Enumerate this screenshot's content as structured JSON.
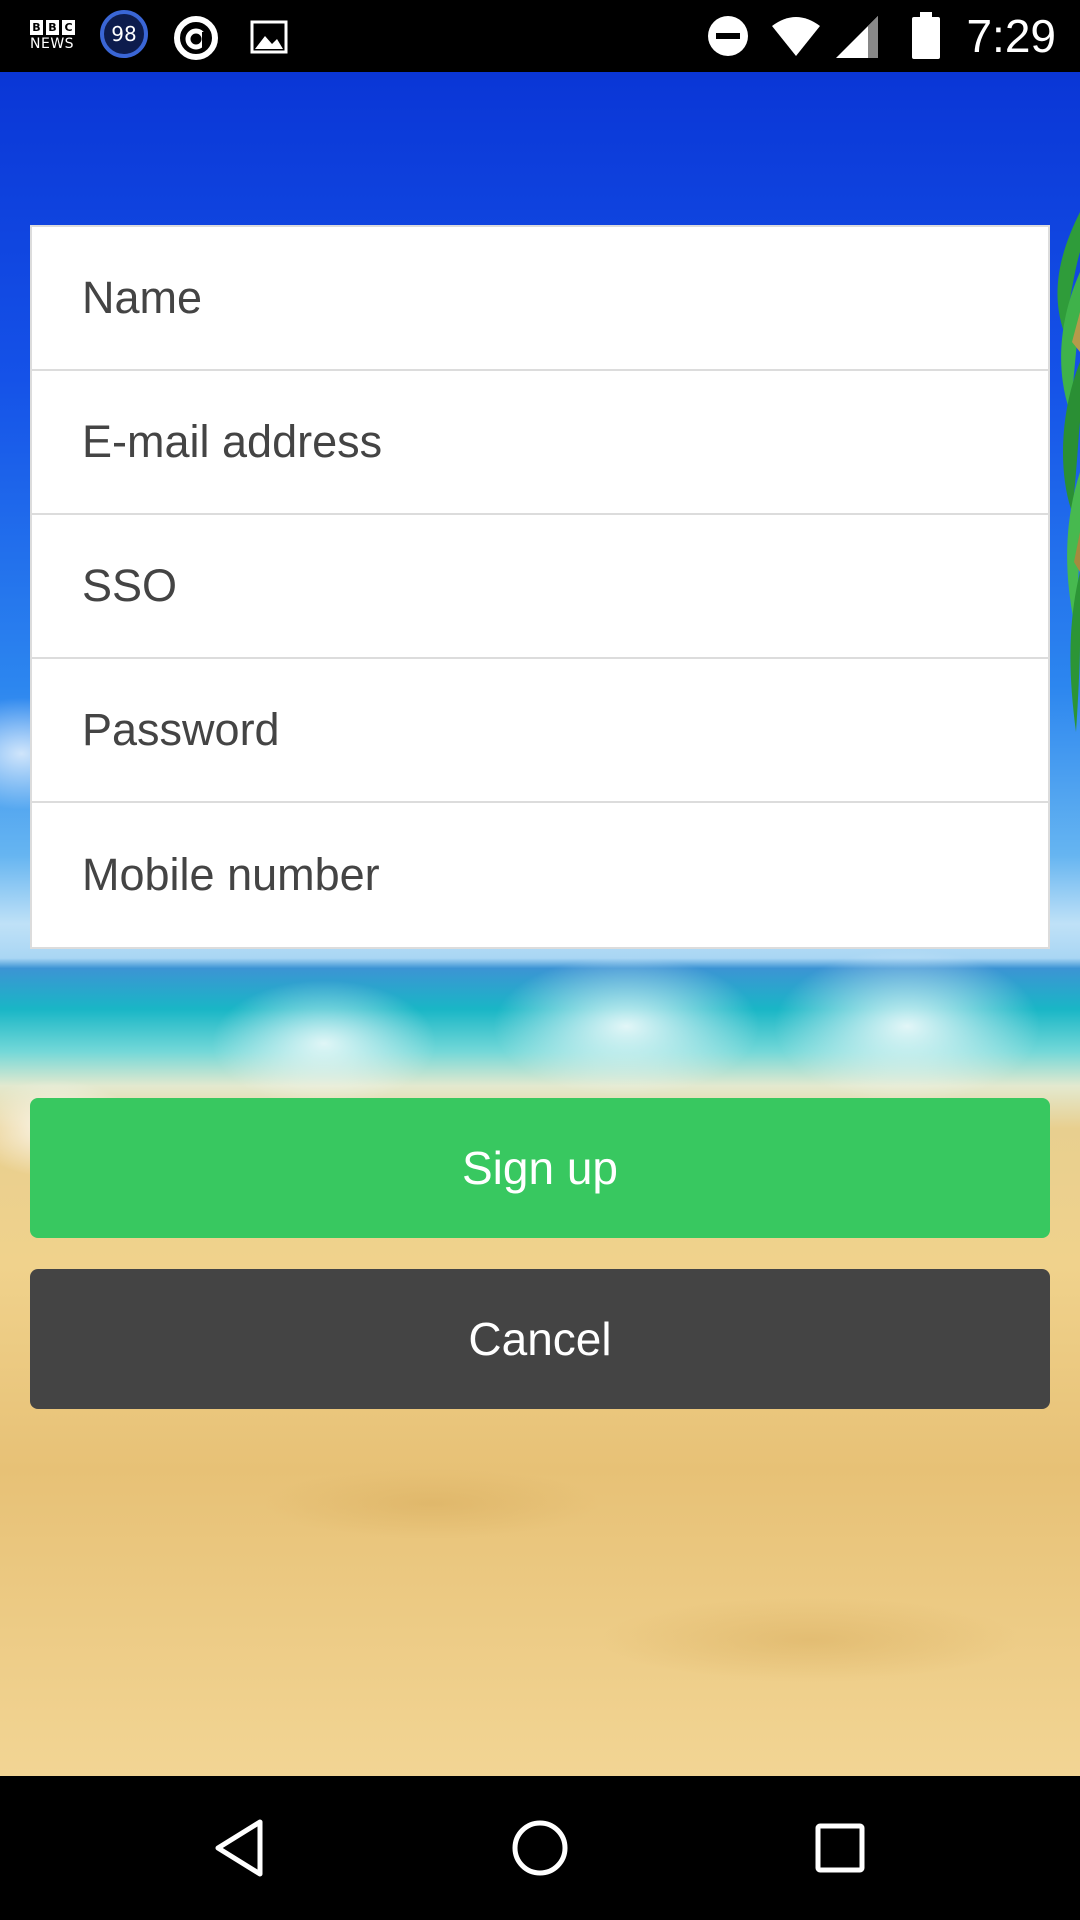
{
  "status_bar": {
    "time": "7:29",
    "bbc_logo_letters": [
      "B",
      "B",
      "C"
    ],
    "bbc_news_label": "NEWS",
    "notification_badge": "98",
    "icons": [
      "bbc-news-icon",
      "notification-count-badge",
      "at-sign-icon",
      "gallery-icon",
      "do-not-disturb-icon",
      "wifi-icon",
      "cell-signal-icon",
      "battery-icon"
    ]
  },
  "form": {
    "fields": [
      {
        "placeholder": "Name",
        "value": ""
      },
      {
        "placeholder": "E-mail address",
        "value": ""
      },
      {
        "placeholder": "SSO",
        "value": ""
      },
      {
        "placeholder": "Password",
        "value": ""
      },
      {
        "placeholder": "Mobile number",
        "value": ""
      }
    ]
  },
  "actions": {
    "signup_label": "Sign up",
    "cancel_label": "Cancel",
    "signup_color": "#38c860",
    "cancel_color": "#444444"
  },
  "nav_bar": {
    "icons": [
      "back-icon",
      "home-icon",
      "recents-icon"
    ]
  }
}
